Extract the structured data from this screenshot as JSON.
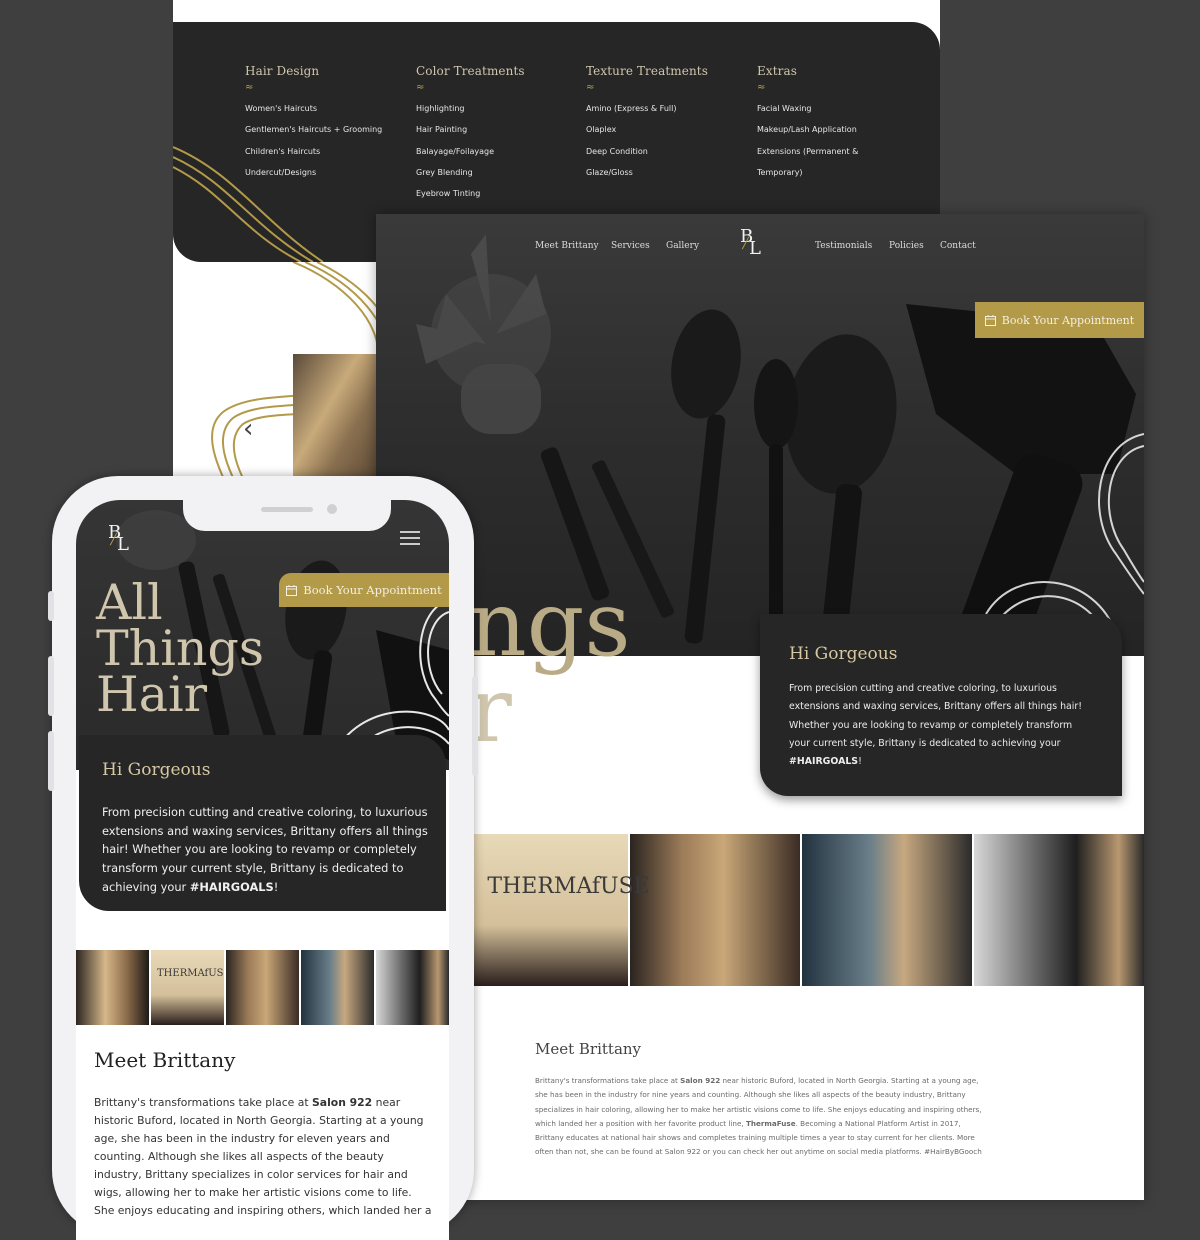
{
  "services": {
    "columns": [
      {
        "title": "Hair Design",
        "items": [
          "Women's Haircuts",
          "Gentlemen's Haircuts + Grooming",
          "Children's Haircuts",
          "Undercut/Designs"
        ]
      },
      {
        "title": "Color Treatments",
        "items": [
          "Highlighting",
          "Hair Painting",
          "Balayage/Foilayage",
          "Grey Blending",
          "Eyebrow Tinting"
        ]
      },
      {
        "title": "Texture Treatments",
        "items": [
          "Amino (Express & Full)",
          "Olaplex",
          "Deep Condition",
          "Glaze/Gloss"
        ]
      },
      {
        "title": "Extras",
        "items": [
          "Facial Waxing",
          "Makeup/Lash Application",
          "Extensions (Permanent &",
          "Temporary)"
        ]
      }
    ],
    "tilde": "≈",
    "prev_arrow": "‹"
  },
  "desktop": {
    "nav_left": [
      "Meet Brittany",
      "Services",
      "Gallery"
    ],
    "nav_right": [
      "Testimonials",
      "Policies",
      "Contact"
    ],
    "logo_b": "B",
    "logo_l": "L",
    "book_button": "Book Your Appointment",
    "hero_line1": "ings",
    "hero_line2": "ir",
    "intro_title": "Hi Gorgeous",
    "intro_text": "From precision cutting and creative coloring, to luxurious extensions and waxing services, Brittany offers all things hair! Whether you are looking to revamp or completely transform your current style, Brittany is dedicated to achieving your",
    "intro_hashtag": "#HAIRGOALS",
    "intro_end": "!",
    "meet_title": "Meet Brittany",
    "meet_p1": "Brittany's transformations take place at ",
    "meet_salon": "Salon 922",
    "meet_p2": " near historic Buford, located in North Georgia. Starting at a young age, she has been in the industry for nine years and counting. Although she likes all aspects of the beauty industry, Brittany specializes in hair coloring, allowing her to make her artistic visions come to life. She enjoys educating and inspiring others, which landed her a position with her favorite product line, ",
    "meet_brand": "ThermaFuse",
    "meet_p3": ". Becoming a National Platform Artist in 2017, Brittany educates at national hair shows and completes training multiple times a year to stay current for her clients. More often than not, she can be found at Salon 922 or you can check her out anytime on social media platforms. #HairByBGooch",
    "strip_caption": "THERMAfUSE"
  },
  "phone": {
    "logo_b": "B",
    "logo_l": "L",
    "book_button": "Book Your Appointment",
    "hero_lines": [
      "All",
      "Things",
      "Hair"
    ],
    "intro_title": "Hi Gorgeous",
    "intro_text": "From precision cutting and creative coloring, to luxurious extensions and waxing services, Brittany offers all things hair! Whether you are looking to revamp or completely transform your current style, Brittany is dedicated to achieving your ",
    "intro_hashtag": "#HAIRGOALS",
    "intro_end": "!",
    "meet_title": "Meet Brittany",
    "meet_p1": "Brittany's transformations take place at ",
    "meet_salon": "Salon 922",
    "meet_p2": " near historic Buford, located in North Georgia. Starting at a young age, she has been in the industry for eleven years and counting. Although she likes all aspects of the beauty industry, Brittany specializes in color services for hair and wigs, allowing her to make her artistic visions come to life. She enjoys educating and inspiring others, which landed her a",
    "strip_caption": "THERMAfUSE"
  },
  "colors": {
    "gold": "#b39a48",
    "panel_dark": "#262626",
    "background": "#3f3f3f"
  }
}
